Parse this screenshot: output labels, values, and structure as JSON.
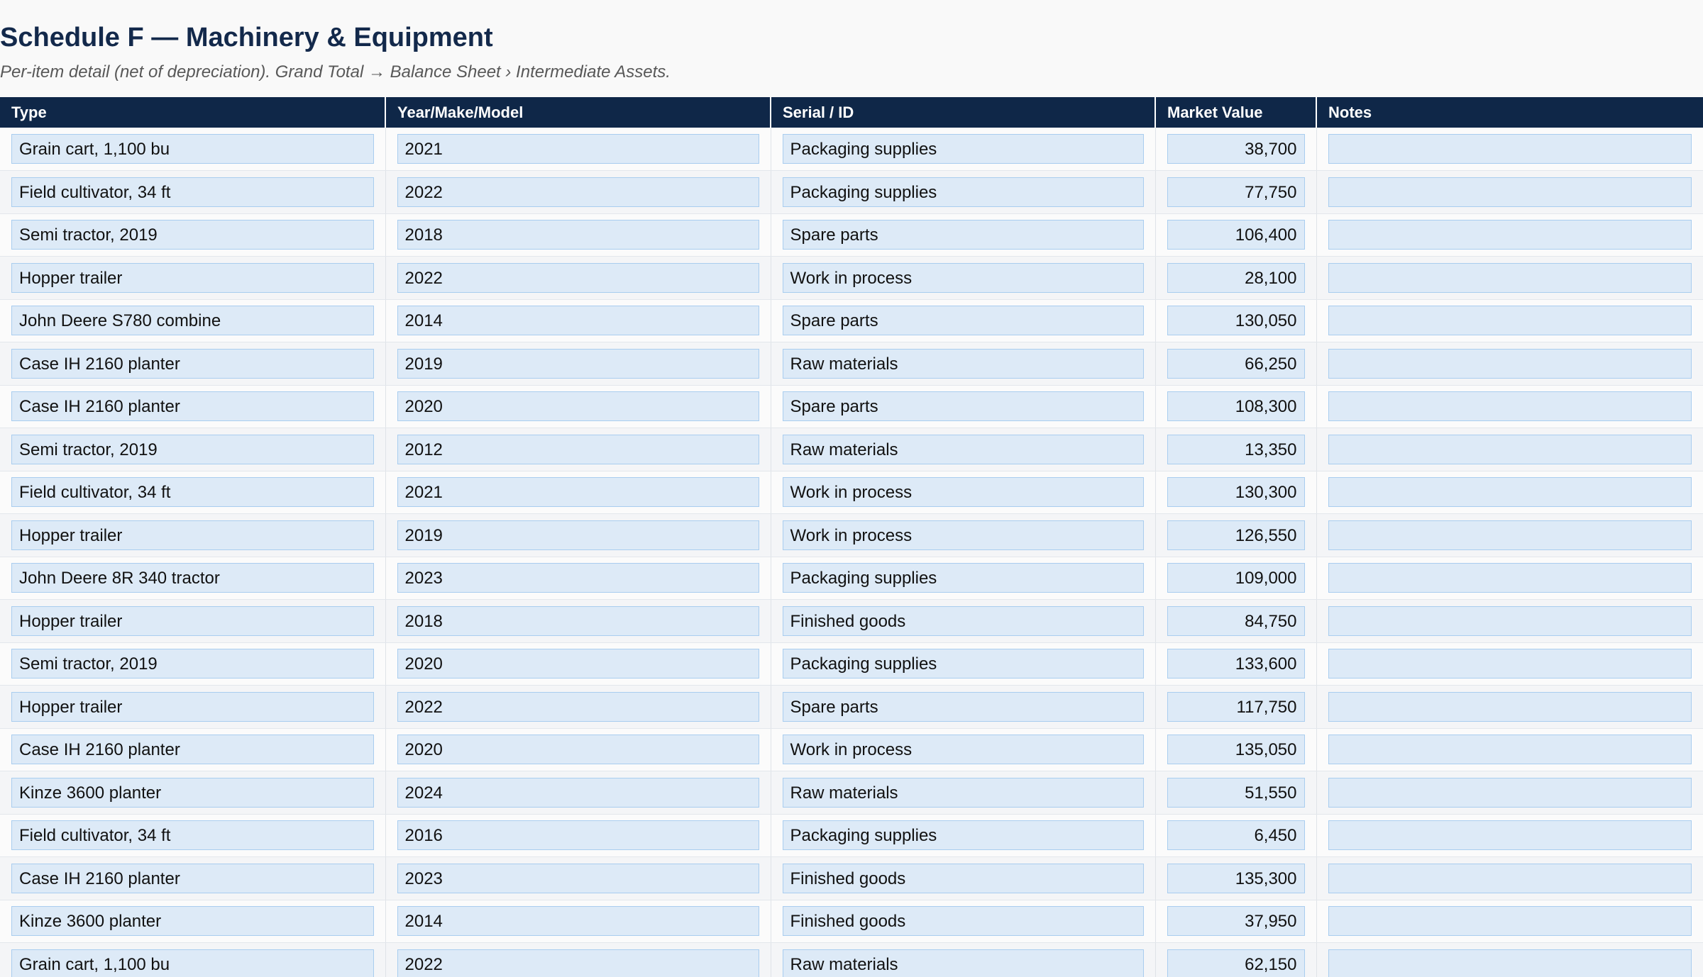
{
  "header": {
    "title": "Schedule F — Machinery & Equipment",
    "subtitle": "Per-item detail (net of depreciation). Grand Total → Balance Sheet › Intermediate Assets."
  },
  "table": {
    "columns": [
      "Type",
      "Year/Make/Model",
      "Serial / ID",
      "Market Value",
      "Notes"
    ],
    "rows": [
      {
        "type": "Grain cart, 1,100 bu",
        "year": "2021",
        "serial": "Packaging supplies",
        "value": "38,700",
        "notes": ""
      },
      {
        "type": "Field cultivator, 34 ft",
        "year": "2022",
        "serial": "Packaging supplies",
        "value": "77,750",
        "notes": ""
      },
      {
        "type": "Semi tractor, 2019",
        "year": "2018",
        "serial": "Spare parts",
        "value": "106,400",
        "notes": ""
      },
      {
        "type": "Hopper trailer",
        "year": "2022",
        "serial": "Work in process",
        "value": "28,100",
        "notes": ""
      },
      {
        "type": "John Deere S780 combine",
        "year": "2014",
        "serial": "Spare parts",
        "value": "130,050",
        "notes": ""
      },
      {
        "type": "Case IH 2160 planter",
        "year": "2019",
        "serial": "Raw materials",
        "value": "66,250",
        "notes": ""
      },
      {
        "type": "Case IH 2160 planter",
        "year": "2020",
        "serial": "Spare parts",
        "value": "108,300",
        "notes": ""
      },
      {
        "type": "Semi tractor, 2019",
        "year": "2012",
        "serial": "Raw materials",
        "value": "13,350",
        "notes": ""
      },
      {
        "type": "Field cultivator, 34 ft",
        "year": "2021",
        "serial": "Work in process",
        "value": "130,300",
        "notes": ""
      },
      {
        "type": "Hopper trailer",
        "year": "2019",
        "serial": "Work in process",
        "value": "126,550",
        "notes": ""
      },
      {
        "type": "John Deere 8R 340 tractor",
        "year": "2023",
        "serial": "Packaging supplies",
        "value": "109,000",
        "notes": ""
      },
      {
        "type": "Hopper trailer",
        "year": "2018",
        "serial": "Finished goods",
        "value": "84,750",
        "notes": ""
      },
      {
        "type": "Semi tractor, 2019",
        "year": "2020",
        "serial": "Packaging supplies",
        "value": "133,600",
        "notes": ""
      },
      {
        "type": "Hopper trailer",
        "year": "2022",
        "serial": "Spare parts",
        "value": "117,750",
        "notes": ""
      },
      {
        "type": "Case IH 2160 planter",
        "year": "2020",
        "serial": "Work in process",
        "value": "135,050",
        "notes": ""
      },
      {
        "type": "Kinze 3600 planter",
        "year": "2024",
        "serial": "Raw materials",
        "value": "51,550",
        "notes": ""
      },
      {
        "type": "Field cultivator, 34 ft",
        "year": "2016",
        "serial": "Packaging supplies",
        "value": "6,450",
        "notes": ""
      },
      {
        "type": "Case IH 2160 planter",
        "year": "2023",
        "serial": "Finished goods",
        "value": "135,300",
        "notes": ""
      },
      {
        "type": "Kinze 3600 planter",
        "year": "2014",
        "serial": "Finished goods",
        "value": "37,950",
        "notes": ""
      },
      {
        "type": "Grain cart, 1,100 bu",
        "year": "2022",
        "serial": "Raw materials",
        "value": "62,150",
        "notes": ""
      }
    ]
  },
  "colors": {
    "header_bg": "#0f2748",
    "title": "#13294b",
    "cell_bg": "#ddeaf7",
    "cell_border": "#a9cdef"
  }
}
